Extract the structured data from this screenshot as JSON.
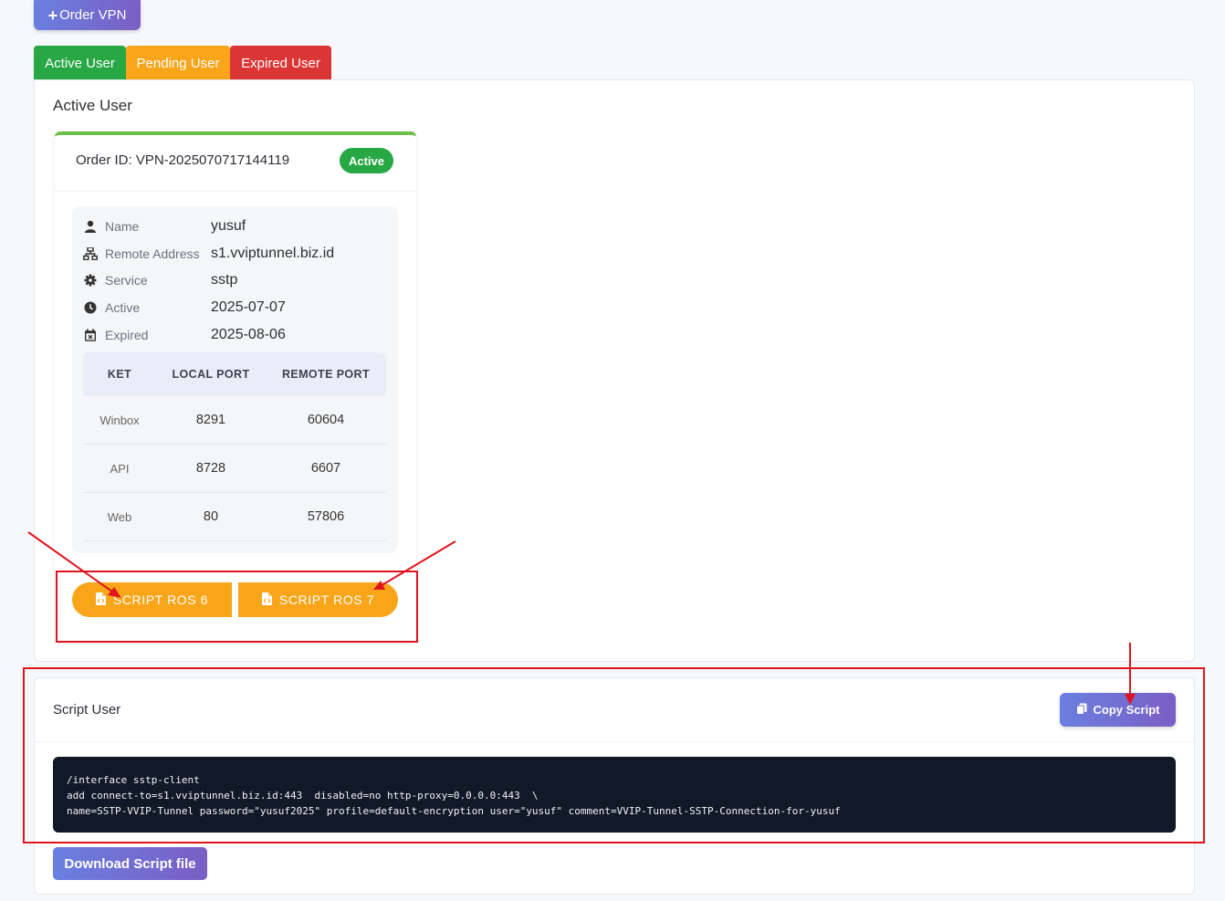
{
  "header": {
    "order_vpn_label": "Order VPN"
  },
  "tabs": [
    {
      "label": "Active User",
      "color": "#28a745"
    },
    {
      "label": "Pending User",
      "color": "#f9a51a"
    },
    {
      "label": "Expired User",
      "color": "#dc3535"
    }
  ],
  "panel": {
    "title": "Active User"
  },
  "card": {
    "order_id": "Order ID: VPN-2025070717144119",
    "status": "Active",
    "fields": [
      {
        "icon": "user-icon",
        "label": "Name",
        "value": "yusuf"
      },
      {
        "icon": "network-icon",
        "label": "Remote Address",
        "value": "s1.vviptunnel.biz.id"
      },
      {
        "icon": "gear-icon",
        "label": "Service",
        "value": "sstp"
      },
      {
        "icon": "clock-icon",
        "label": "Active",
        "value": "2025-07-07"
      },
      {
        "icon": "calendar-x-icon",
        "label": "Expired",
        "value": "2025-08-06"
      }
    ],
    "ports": {
      "headers": [
        "KET",
        "LOCAL PORT",
        "REMOTE PORT"
      ],
      "rows": [
        [
          "Winbox",
          "8291",
          "60604"
        ],
        [
          "API",
          "8728",
          "6607"
        ],
        [
          "Web",
          "80",
          "57806"
        ]
      ]
    },
    "buttons": {
      "ros6": "SCRIPT ROS 6",
      "ros7": "SCRIPT ROS 7"
    }
  },
  "script": {
    "title": "Script User",
    "copy_label": "Copy Script",
    "code_lines": [
      "/interface sstp-client",
      "add connect-to=s1.vviptunnel.biz.id:443  disabled=no http-proxy=0.0.0.0:443  \\",
      "name=SSTP-VVIP-Tunnel password=\"yusuf2025\" profile=default-encryption user=\"yusuf\" comment=VVIP-Tunnel-SSTP-Connection-for-yusuf"
    ],
    "download_label": "Download Script file"
  },
  "colors": {
    "accent": "#6a7fe0",
    "success": "#28a745",
    "warning": "#f9a51a",
    "danger": "#dc3535",
    "annotation": "#e0141e"
  }
}
